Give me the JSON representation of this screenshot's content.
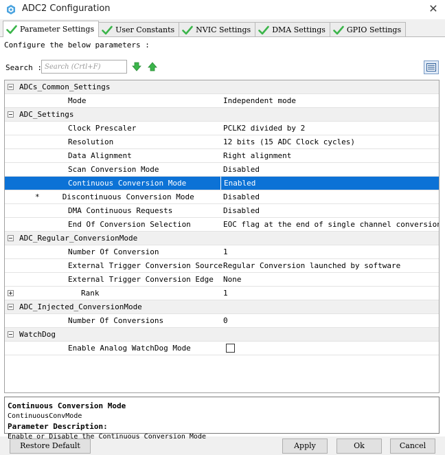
{
  "window": {
    "title": "ADC2 Configuration",
    "close_glyph": "✕",
    "icon": "cube-logo-icon"
  },
  "tabs": [
    {
      "label": "Parameter Settings",
      "active": true,
      "icon": "green-check-icon"
    },
    {
      "label": "User Constants",
      "active": false,
      "icon": "green-check-icon"
    },
    {
      "label": "NVIC Settings",
      "active": false,
      "icon": "green-check-icon"
    },
    {
      "label": "DMA Settings",
      "active": false,
      "icon": "green-check-icon"
    },
    {
      "label": "GPIO Settings",
      "active": false,
      "icon": "green-check-icon"
    }
  ],
  "hint": "Configure the below parameters :",
  "search": {
    "label": "Search :",
    "placeholder": "Search (Crtl+F)",
    "value": ""
  },
  "colors": {
    "accent_selected": "#0c72d6",
    "check_green": "#3bb54a"
  },
  "groups": [
    {
      "name": "ADCs_Common_Settings",
      "params": [
        {
          "name": "Mode",
          "value": "Independent mode"
        }
      ]
    },
    {
      "name": "ADC_Settings",
      "params": [
        {
          "name": "Clock Prescaler",
          "value": "PCLK2 divided by 2"
        },
        {
          "name": "Resolution",
          "value": "12 bits (15 ADC Clock cycles)"
        },
        {
          "name": "Data Alignment",
          "value": "Right alignment"
        },
        {
          "name": "Scan Conversion Mode",
          "value": "Disabled"
        },
        {
          "name": "Continuous Conversion Mode",
          "value": "Enabled",
          "selected": true
        },
        {
          "name": "*     Discontinuous Conversion Mode",
          "value": "Disabled"
        },
        {
          "name": "DMA Continuous Requests",
          "value": "Disabled"
        },
        {
          "name": "End Of Conversion Selection",
          "value": "EOC flag at the end of single channel conversion"
        }
      ]
    },
    {
      "name": "ADC_Regular_ConversionMode",
      "params": [
        {
          "name": "Number Of Conversion",
          "value": "1"
        },
        {
          "name": "External Trigger Conversion Source",
          "value": "Regular Conversion launched by software"
        },
        {
          "name": "External Trigger Conversion Edge",
          "value": "None"
        },
        {
          "name": "Rank",
          "value": "1",
          "expandable": true
        }
      ]
    },
    {
      "name": "ADC_Injected_ConversionMode",
      "params": [
        {
          "name": "Number Of Conversions",
          "value": "0"
        }
      ]
    },
    {
      "name": "WatchDog",
      "params": [
        {
          "name": "Enable Analog WatchDog Mode",
          "value": "",
          "checkbox": true,
          "checked": false
        }
      ]
    }
  ],
  "description": {
    "title": "Continuous Conversion Mode",
    "id": "ContinuousConvMode",
    "heading": "Parameter Description:",
    "text": "Enable or Disable the Continuous Conversion Mode"
  },
  "buttons": {
    "restore": "Restore Default",
    "apply": "Apply",
    "ok": "Ok",
    "cancel": "Cancel"
  }
}
